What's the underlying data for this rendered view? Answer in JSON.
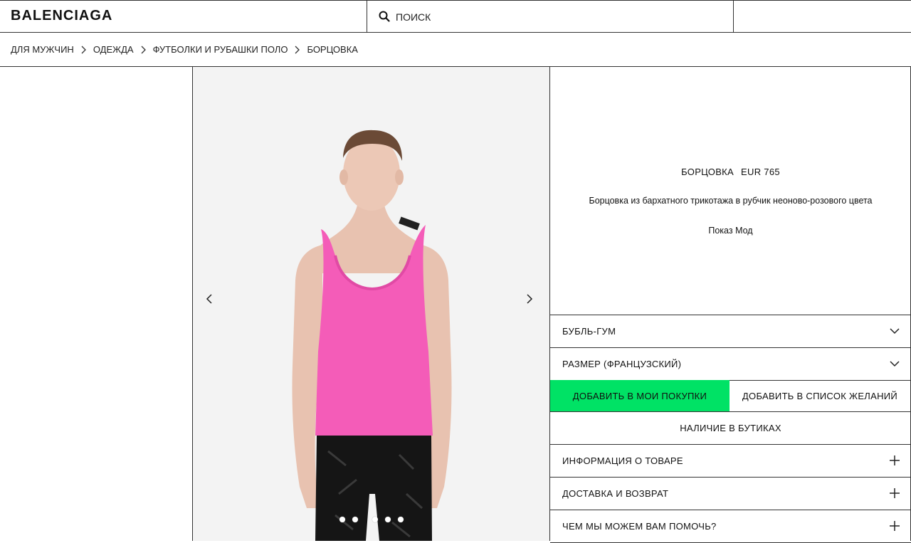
{
  "header": {
    "logo": "BALENCIAGA",
    "search_placeholder": "ПОИСК"
  },
  "breadcrumb": [
    "ДЛЯ МУЖЧИН",
    "ОДЕЖДА",
    "ФУТБОЛКИ И РУБАШКИ ПОЛО",
    "БОРЦОВКА"
  ],
  "product": {
    "name": "БОРЦОВКА",
    "price": "EUR 765",
    "description": "Борцовка из бархатного трикотажа в рубчик неоново-розового цвета",
    "show_label": "Показ Мод",
    "color_select": "БУБЛЬ-ГУМ",
    "size_select": "РАЗМЕР (ФРАНЦУЗСКИЙ)"
  },
  "actions": {
    "add_to_cart": "ДОБАВИТЬ В МОИ ПОКУПКИ",
    "add_to_wishlist": "ДОБАВИТЬ В СПИСОК ЖЕЛАНИЙ",
    "boutique_availability": "НАЛИЧИЕ В БУТИКАХ"
  },
  "accordions": [
    {
      "label": "ИНФОРМАЦИЯ О ТОВАРЕ"
    },
    {
      "label": "ДОСТАВКА И ВОЗВРАТ"
    },
    {
      "label": "ЧЕМ МЫ МОЖЕМ ВАМ ПОМОЧЬ?"
    }
  ],
  "gallery": {
    "image_count": 5,
    "active_index": 0
  },
  "colors": {
    "add_button_bg": "#00e265",
    "tank_pink": "#f45cb8",
    "border": "#333333"
  },
  "icons": [
    "search-icon",
    "chevron-right-icon",
    "chevron-left-icon",
    "chevron-down-icon",
    "plus-icon"
  ]
}
